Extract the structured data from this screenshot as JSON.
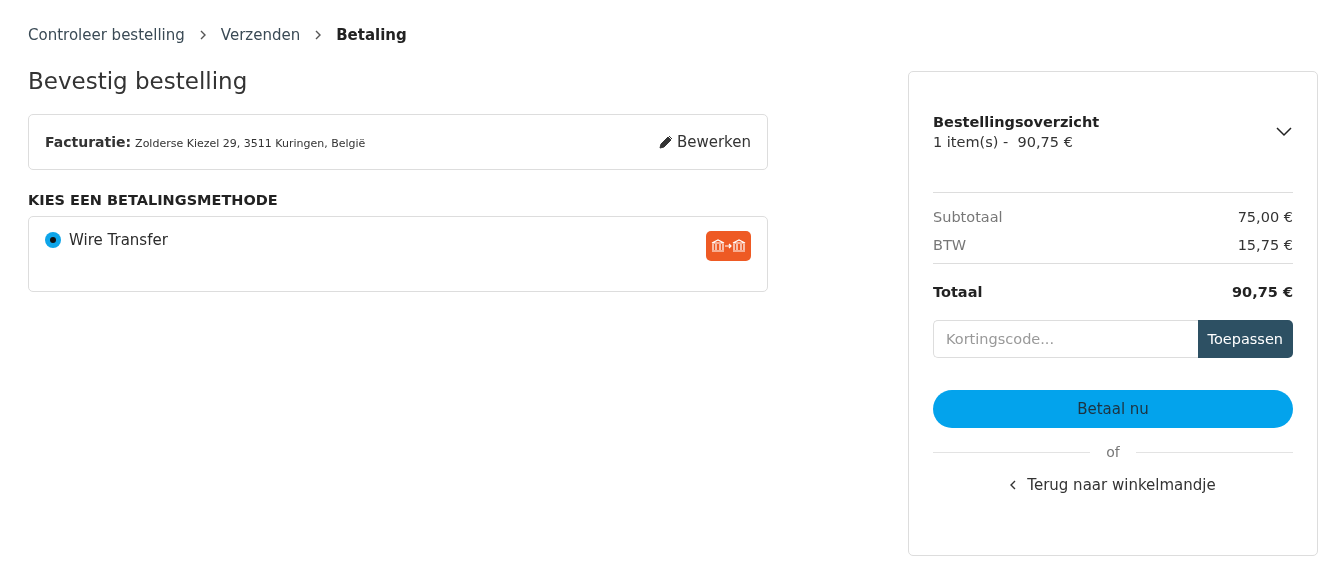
{
  "breadcrumbs": [
    {
      "label": "Controleer bestelling",
      "selected": false
    },
    {
      "label": "Verzenden",
      "selected": false
    },
    {
      "label": "Betaling",
      "selected": true
    }
  ],
  "title": "Bevestig bestelling",
  "billing": {
    "label": "Facturatie:",
    "address": "Zolderse Kiezel 29, 3511 Kuringen, België",
    "edit": "Bewerken"
  },
  "payment_heading": "KIES EEN BETALINGSMETHODE",
  "payment_methods": [
    {
      "label": "Wire Transfer",
      "selected": true
    }
  ],
  "summary": {
    "title": "Bestellingsoverzicht",
    "subtitle": "1 item(s) -  90,75 €",
    "expanded": false,
    "lines": [
      {
        "label": "Subtotaal",
        "value": "75,00 €"
      },
      {
        "label": "BTW",
        "value": "15,75 €"
      }
    ],
    "total": {
      "label": "Totaal",
      "value": "90,75 €"
    },
    "coupon": {
      "placeholder": "Kortingscode...",
      "button": "Toepassen"
    },
    "pay_button": "Betaal nu",
    "separator": "of",
    "back_link": "Terug naar winkelmandje"
  }
}
